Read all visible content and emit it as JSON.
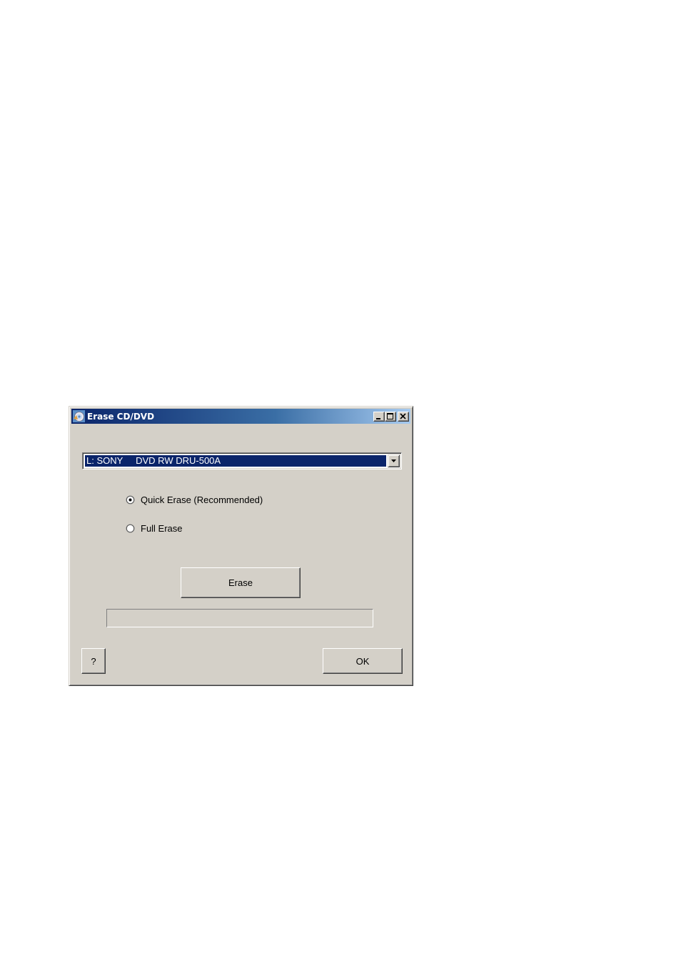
{
  "window": {
    "title": "Erase CD/DVD",
    "icon": "cd-dvd-app-icon",
    "controls": [
      "minimize-icon",
      "maximize-icon",
      "close-icon"
    ]
  },
  "drive_select": {
    "selected": "L: SONY     DVD RW DRU-500A"
  },
  "erase_mode": {
    "options": [
      {
        "label": "Quick Erase (Recommended)",
        "checked": true
      },
      {
        "label": "Full Erase",
        "checked": false
      }
    ]
  },
  "actions": {
    "erase_label": "Erase",
    "help_label": "?",
    "ok_label": "OK"
  },
  "progress": {
    "fraction": 0
  },
  "colors": {
    "face": "#d4d0c8",
    "title_active_start": "#0a246a",
    "title_active_end": "#a6caf0",
    "selection": "#0a246a"
  }
}
